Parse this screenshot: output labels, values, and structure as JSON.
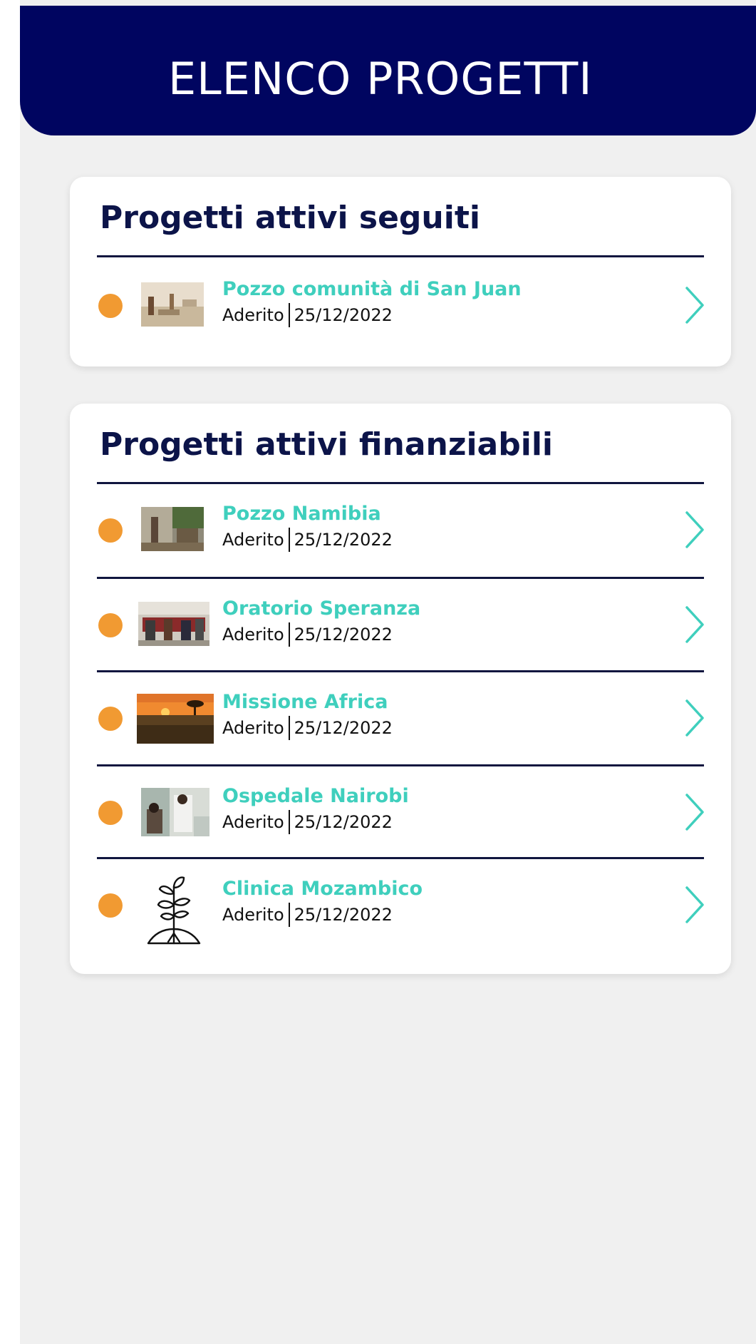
{
  "header": {
    "title": "ELENCO PROGETTI"
  },
  "colors": {
    "header_bg": "#000560",
    "accent": "#3fcfbd",
    "dot": "#f19a32",
    "title": "#0c1449"
  },
  "followed": {
    "title": "Progetti attivi seguiti",
    "items": [
      {
        "name": "Pozzo comunità di San Juan",
        "status": "Aderito",
        "date": "25/12/2022",
        "thumb_icon": "photo-well-icon"
      }
    ]
  },
  "fundable": {
    "title": "Progetti attivi finanziabili",
    "items": [
      {
        "name": "Pozzo Namibia",
        "status": "Aderito",
        "date": "25/12/2022",
        "thumb_icon": "photo-village-icon"
      },
      {
        "name": "Oratorio Speranza",
        "status": "Aderito",
        "date": "25/12/2022",
        "thumb_icon": "photo-group-icon"
      },
      {
        "name": "Missione Africa",
        "status": "Aderito",
        "date": "25/12/2022",
        "thumb_icon": "photo-sunset-icon"
      },
      {
        "name": "Ospedale Nairobi",
        "status": "Aderito",
        "date": "25/12/2022",
        "thumb_icon": "photo-hospital-icon"
      },
      {
        "name": "Clinica Mozambico",
        "status": "Aderito",
        "date": "25/12/2022",
        "thumb_icon": "plant-icon"
      }
    ]
  }
}
